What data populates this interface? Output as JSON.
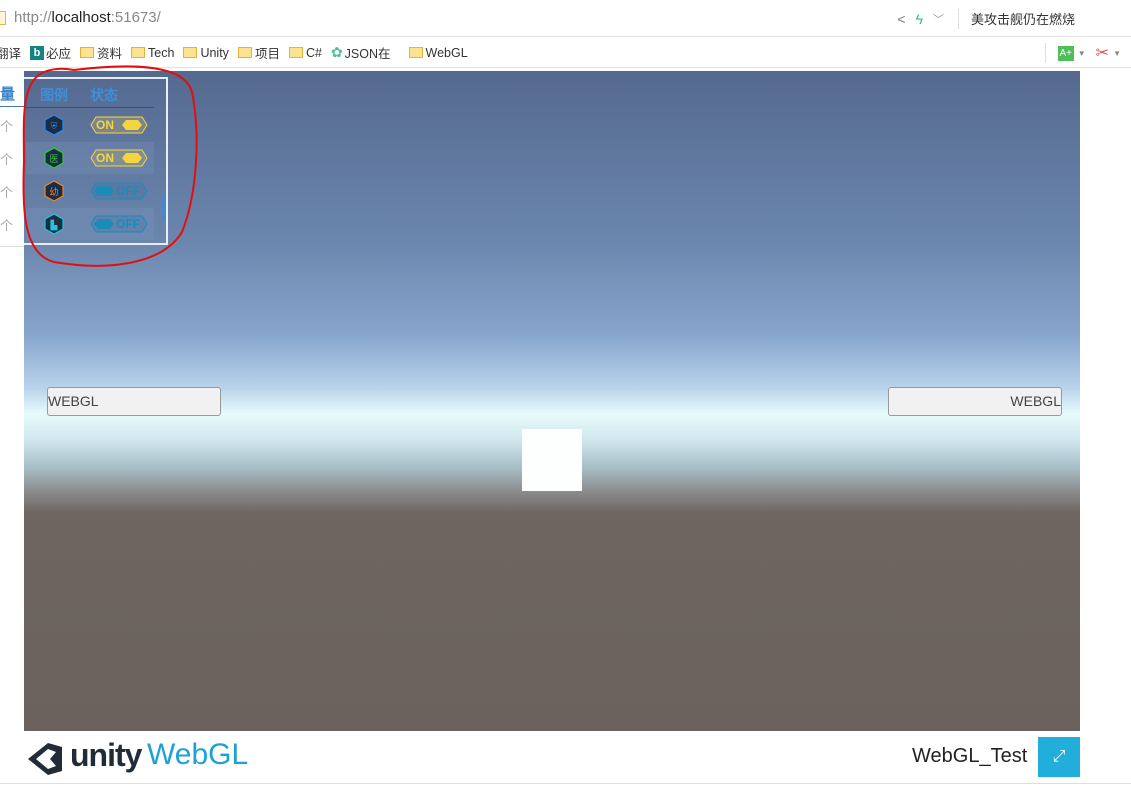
{
  "browser": {
    "url_prefix": "http://",
    "url_host": "localhost",
    "url_suffix": ":51673/",
    "news_ticker": "美攻击舰仍在燃烧",
    "bookmarks": [
      {
        "label": "翻译",
        "icon": "translate"
      },
      {
        "label": "必应",
        "icon": "bing-icon"
      },
      {
        "label": "资料",
        "icon": "folder-icon"
      },
      {
        "label": "Tech",
        "icon": "folder-icon"
      },
      {
        "label": "Unity",
        "icon": "folder-icon"
      },
      {
        "label": "项目",
        "icon": "folder-icon"
      },
      {
        "label": "C#",
        "icon": "folder-icon"
      },
      {
        "label": "JSON在",
        "icon": "gear-icon"
      },
      {
        "label": "WebGL",
        "icon": "folder-icon"
      }
    ]
  },
  "side_table": {
    "header_partial": "量",
    "row_partial": [
      "个",
      "个",
      "个",
      "个"
    ]
  },
  "legend_panel": {
    "headers": {
      "legend": "图例",
      "status": "状态"
    },
    "rows": [
      {
        "icon": "shield-icon",
        "glyph": "⛨",
        "color": "#2a8ee6",
        "status": "ON",
        "on": true
      },
      {
        "icon": "hospital-icon",
        "glyph": "医",
        "color": "#2ecb3a",
        "status": "ON",
        "on": true
      },
      {
        "icon": "kindergarten-icon",
        "glyph": "幼",
        "color": "#f08a1c",
        "status": "OFF",
        "on": false
      },
      {
        "icon": "building-icon",
        "glyph": "▙",
        "color": "#22c6d6",
        "status": "OFF",
        "on": false
      }
    ],
    "colors": {
      "on": "#f5d442",
      "off": "#1b8bb8"
    }
  },
  "scene": {
    "left_input": "WEBGL",
    "right_input": "WEBGL"
  },
  "footer": {
    "logo_unity": "unity",
    "logo_webgl": "WebGL",
    "title": "WebGL_Test",
    "fullscreen_icon": "⤢"
  }
}
